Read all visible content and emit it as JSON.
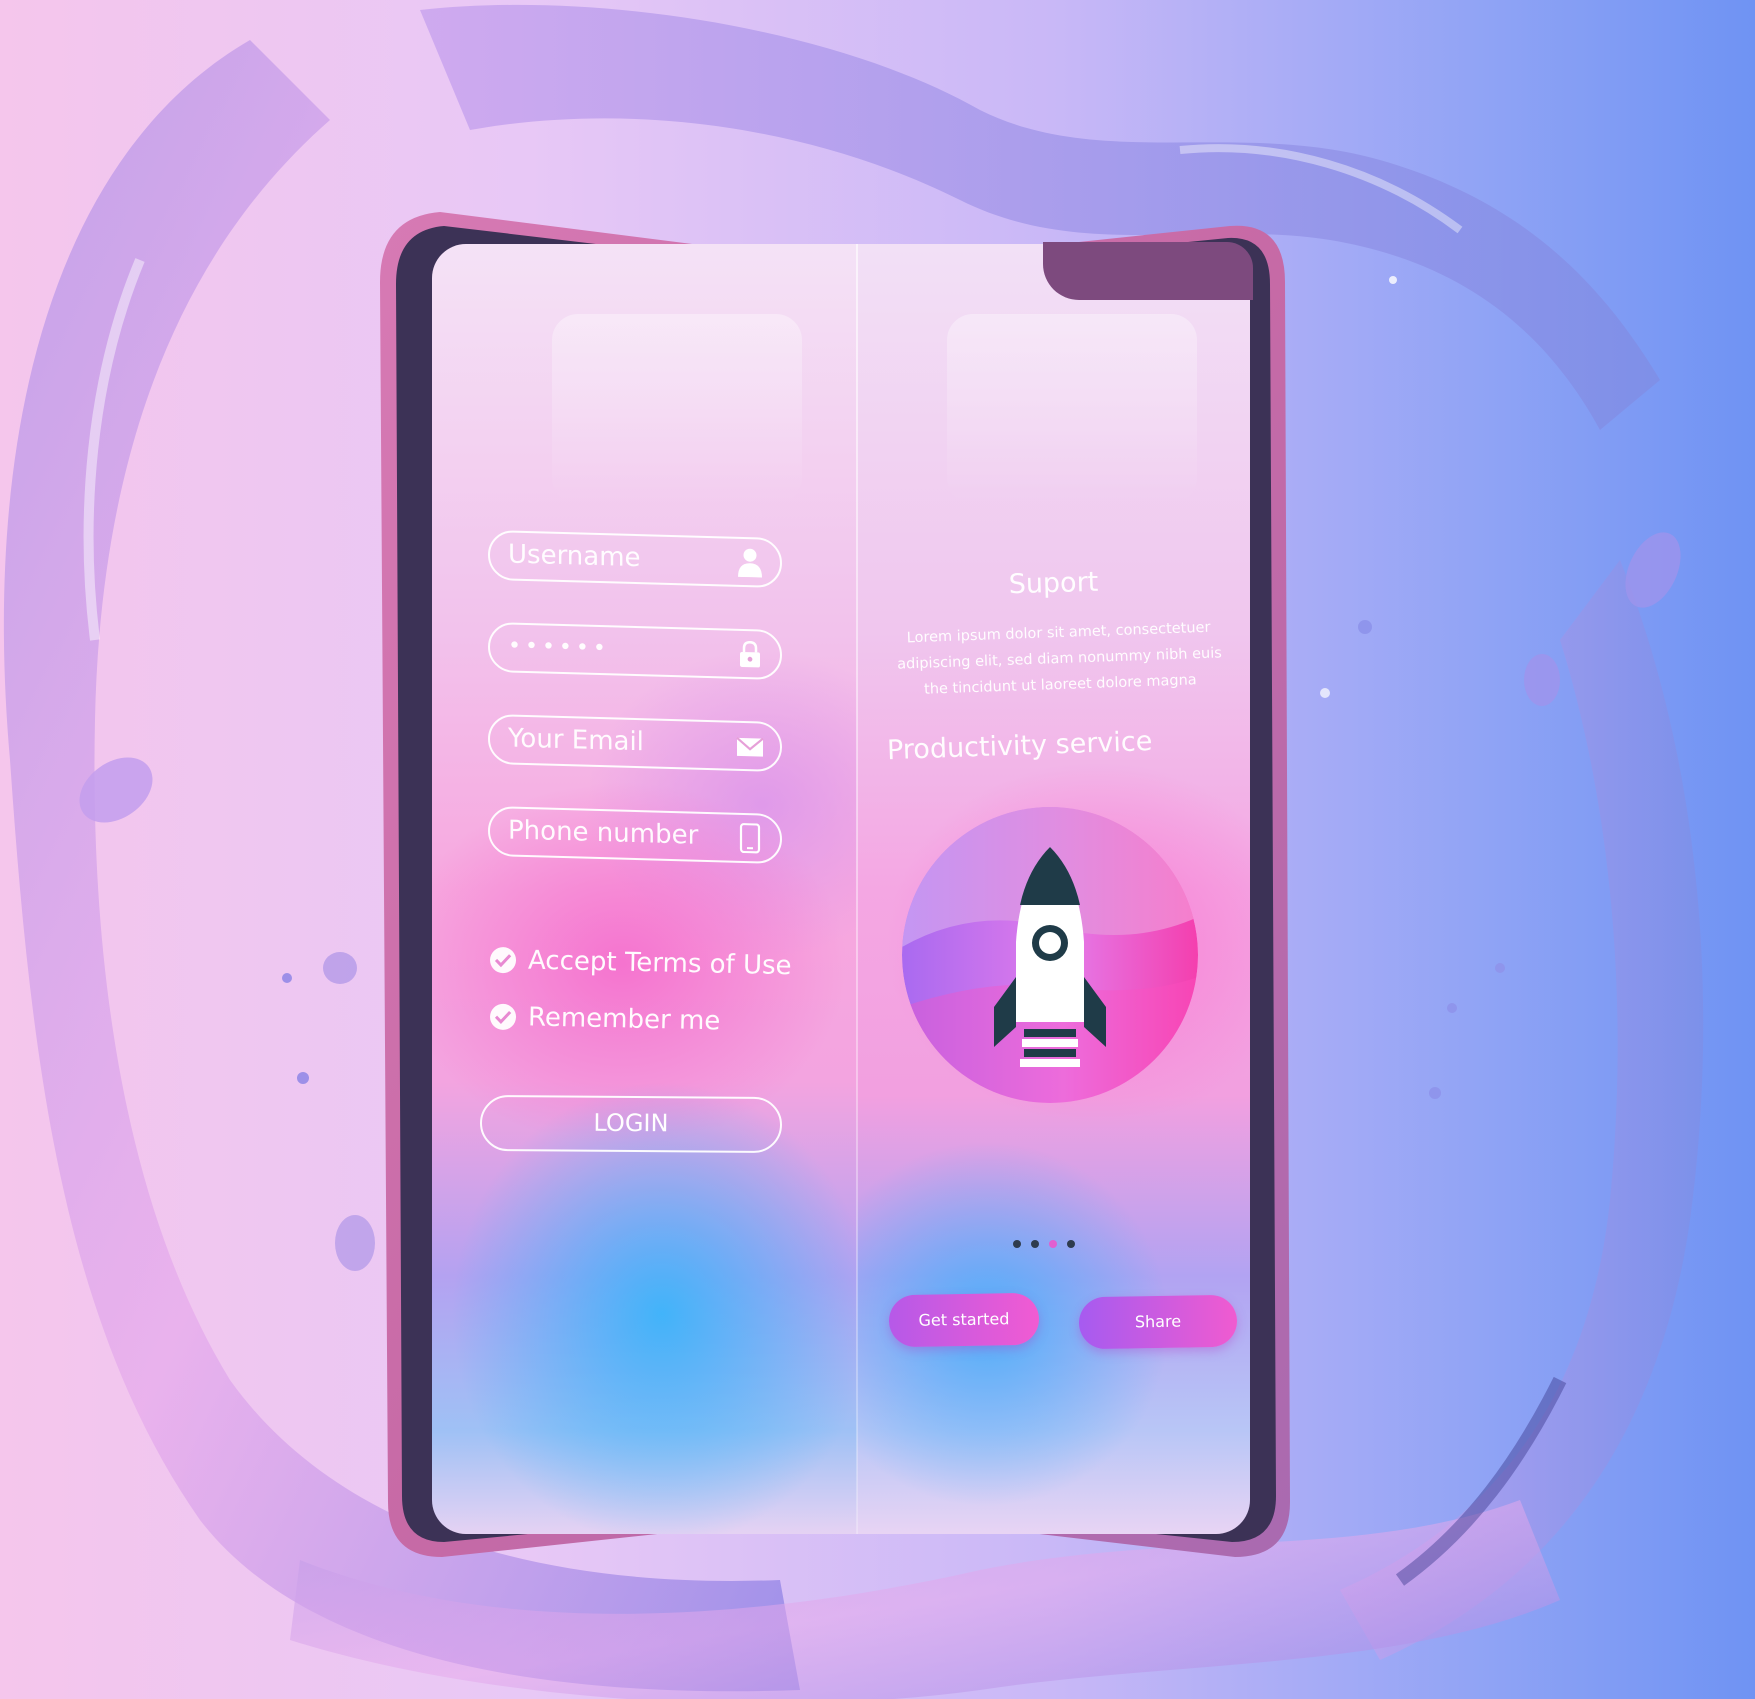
{
  "login_form": {
    "username_placeholder": "Username",
    "password_value": "••••••",
    "email_placeholder": "Your Email",
    "phone_placeholder": "Phone number",
    "accept_terms_label": "Accept Terms of Use",
    "remember_me_label": "Remember me",
    "login_label": "LOGIN"
  },
  "support_panel": {
    "title": "Suport",
    "body_lines": [
      "Lorem ipsum dolor sit amet, consectetuer",
      "adipiscing elit, sed diam nonummy nibh euis",
      "the tincidunt ut laoreet dolore magna"
    ],
    "service_title": "Productivity service",
    "carousel_total": 4,
    "carousel_active_index": 2,
    "get_started_label": "Get started",
    "share_label": "Share"
  },
  "icons": {
    "username": "user-icon",
    "password": "lock-icon",
    "email": "envelope-icon",
    "phone": "smartphone-icon",
    "check": "check-icon",
    "illustration": "rocket-icon"
  },
  "colors": {
    "accent_pink": "#e84fcf",
    "accent_purple": "#a55cf0",
    "rocket_dark": "#1f3b48",
    "dot_dark": "#2f3c4e",
    "dot_active": "#e15fd0"
  }
}
